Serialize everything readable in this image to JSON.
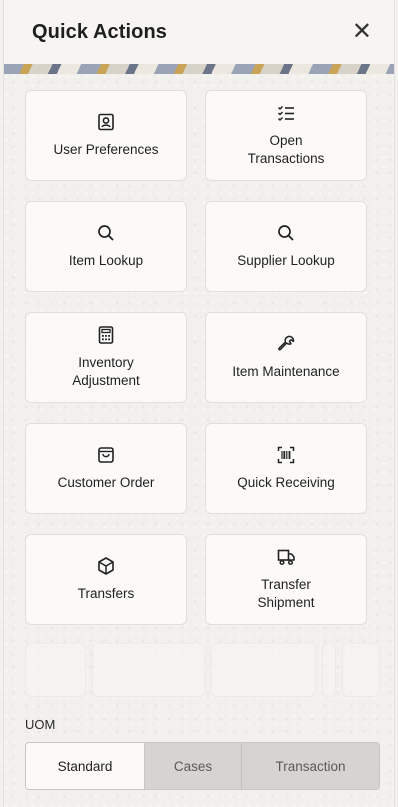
{
  "header": {
    "title": "Quick Actions",
    "close_icon": "close-icon"
  },
  "actions": [
    {
      "label": "User Preferences",
      "icon": "user-badge-icon"
    },
    {
      "label": "Open Transactions",
      "icon": "checklist-icon"
    },
    {
      "label": "Item Lookup",
      "icon": "search-icon"
    },
    {
      "label": "Supplier Lookup",
      "icon": "search-icon"
    },
    {
      "label": "Inventory Adjustment",
      "icon": "calculator-icon"
    },
    {
      "label": "Item Maintenance",
      "icon": "wrench-icon"
    },
    {
      "label": "Customer Order",
      "icon": "shopping-bag-icon"
    },
    {
      "label": "Quick Receiving",
      "icon": "barcode-scan-icon"
    },
    {
      "label": "Transfers",
      "icon": "package-icon"
    },
    {
      "label": "Transfer Shipment",
      "icon": "truck-icon"
    }
  ],
  "uom": {
    "label": "UOM",
    "options": [
      "Standard",
      "Cases",
      "Transaction"
    ],
    "selected": "Standard"
  }
}
